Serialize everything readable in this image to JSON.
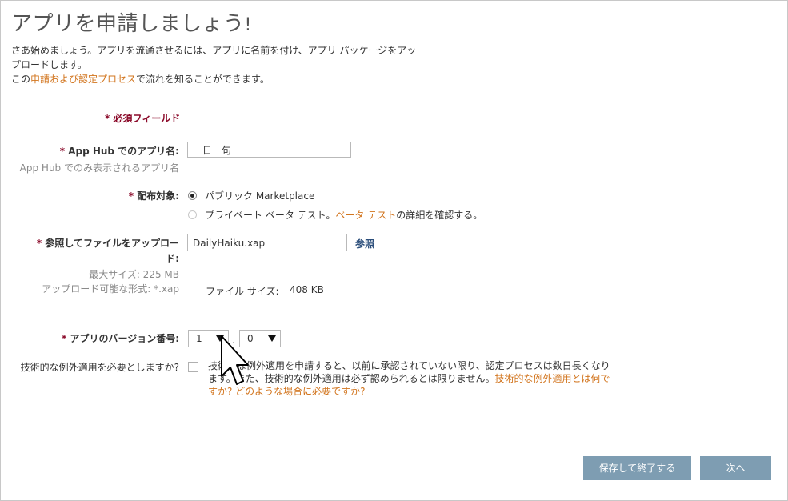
{
  "page": {
    "title": "アプリを申請しましょう",
    "title_bang": "!",
    "intro_line1": "さあ始めましょう。アプリを流通させるには、アプリに名前を付け、アプリ パッケージをアッ",
    "intro_line2": "プロードします。",
    "intro_line3_pre": "この",
    "intro_line3_link": "申請および認定プロセス",
    "intro_line3_post": "で流れを知ることができます。"
  },
  "form": {
    "required_note": "* 必須フィールド",
    "app_name": {
      "star": "* ",
      "label": "App Hub でのアプリ名:",
      "hint": "App Hub でのみ表示されるアプリ名",
      "value": "一日一句"
    },
    "distribution": {
      "star": "* ",
      "label": "配布対象:",
      "option_public": "パブリック Marketplace",
      "option_private_pre": "プライベート ベータ テスト。",
      "option_private_link": "ベータ テスト",
      "option_private_post": "の詳細を確認する。"
    },
    "upload": {
      "star": "* ",
      "label_line1": "参照してファイルをアップロー",
      "label_line2": "ド:",
      "max_size": "最大サイズ: 225 MB",
      "formats": "アップロード可能な形式: *.xap",
      "file_value": "DailyHaiku.xap",
      "browse_label": "参照",
      "file_size_label": "ファイル サイズ:",
      "file_size_value": "408 KB"
    },
    "version": {
      "star": "* ",
      "label": "アプリのバージョン番号:",
      "major": "1",
      "separator": ".",
      "minor": "0"
    },
    "exception": {
      "label": "技術的な例外適用を必要としますか?",
      "text_line1": "技術的な例外適用を申請すると、以前に承認されていない限り、認定プロセスは数日長くなり",
      "text_line2_pre": "ます。また、技術的な例外適用は必ず認められるとは限りません。",
      "text_line2_link": "技術的な例外適用とは何で",
      "text_line3_link": "すか? どのような場合に必要ですか?"
    }
  },
  "buttons": {
    "save_exit": "保存して終了する",
    "next": "次へ"
  },
  "colors": {
    "accent_link": "#d2751e",
    "required": "#8b0a2a",
    "button": "#7e9db2"
  },
  "icons": [
    "mouse-cursor-icon",
    "dropdown-arrow-icon",
    "radio-icon",
    "checkbox-icon"
  ]
}
